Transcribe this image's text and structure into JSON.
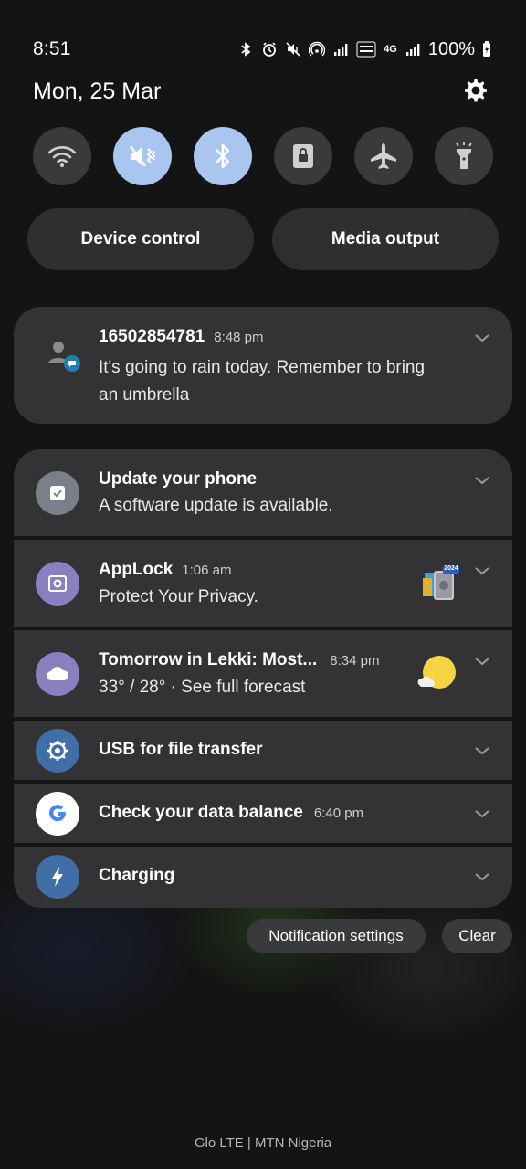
{
  "status_bar": {
    "time": "8:51",
    "network_label": "4G",
    "battery": "100%"
  },
  "header": {
    "date": "Mon, 25 Mar",
    "settings_icon": "gear-icon"
  },
  "quick_toggles": [
    {
      "name": "wifi",
      "icon": "wifi-icon",
      "active": false
    },
    {
      "name": "sound",
      "icon": "mute-vibrate-icon",
      "active": true
    },
    {
      "name": "bluetooth",
      "icon": "bluetooth-icon",
      "active": true
    },
    {
      "name": "lock",
      "icon": "lock-rotation-icon",
      "active": false
    },
    {
      "name": "airplane",
      "icon": "airplane-icon",
      "active": false
    },
    {
      "name": "flashlight",
      "icon": "flashlight-icon",
      "active": false
    }
  ],
  "pills": {
    "device_control": "Device control",
    "media_output": "Media output"
  },
  "message": {
    "sender": "16502854781",
    "time": "8:48 pm",
    "line1": "It's going to rain today. Remember to bring",
    "line2": "an umbrella"
  },
  "notifications": [
    {
      "title": "Update your phone",
      "time": "",
      "body": "A software update is available."
    },
    {
      "title": "AppLock",
      "time": "1:06 am",
      "body": "Protect Your Privacy."
    },
    {
      "title": "Tomorrow in Lekki: Most...",
      "time": "8:34 pm",
      "body": "33° / 28° · See full forecast"
    },
    {
      "title": "USB for file transfer",
      "time": "",
      "body": ""
    },
    {
      "title": "Check your data balance",
      "time": "6:40 pm",
      "body": ""
    },
    {
      "title": "Charging",
      "time": "",
      "body": ""
    }
  ],
  "applock_badge": "2024",
  "actions": {
    "notification_settings": "Notification settings",
    "clear": "Clear"
  },
  "carrier": "Glo LTE | MTN Nigeria",
  "colors": {
    "active_toggle": "#a8c6ef",
    "card": "#333335",
    "applock_icon": "#8c7fc0",
    "weather_icon": "#8c7fc0",
    "usb_icon": "#3f6fa6",
    "charging_icon": "#3f6fa6"
  }
}
